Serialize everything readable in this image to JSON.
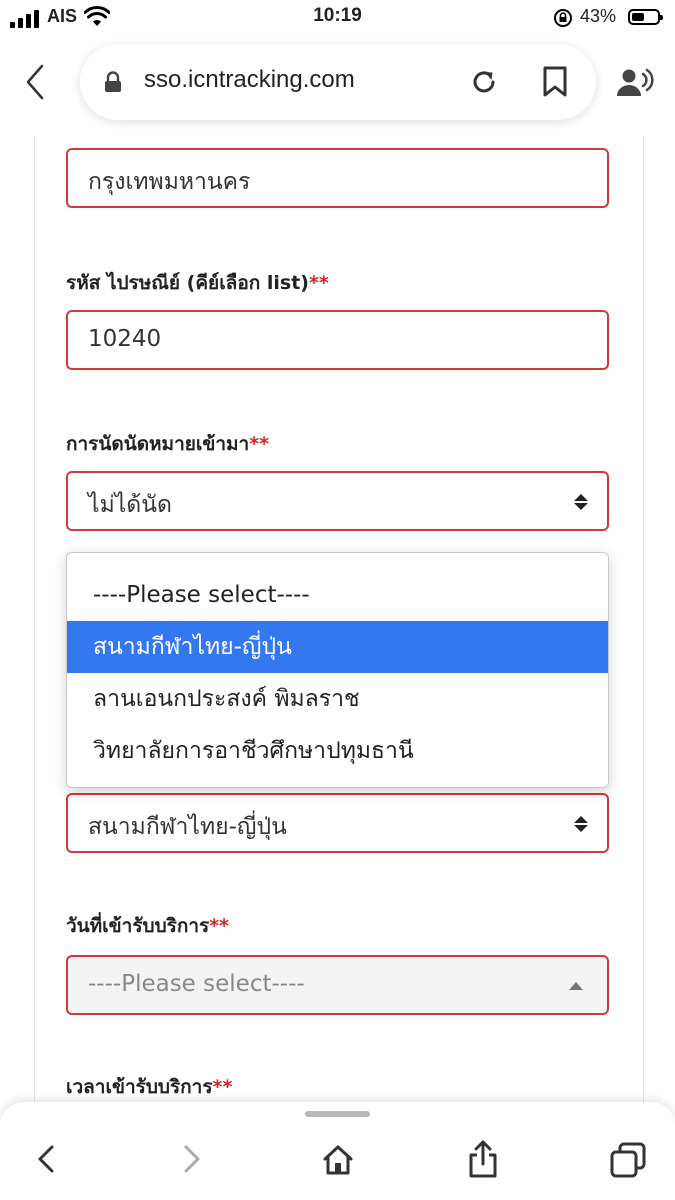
{
  "status_bar": {
    "carrier": "AIS",
    "time": "10:19",
    "battery": "43%",
    "icons": [
      "signal-icon",
      "wifi-icon",
      "orientation-lock-icon",
      "battery-icon"
    ]
  },
  "browser": {
    "url": "sso.icntracking.com",
    "icons": [
      "back-icon",
      "lock-icon",
      "reload-icon",
      "bookmark-icon",
      "reader-voice-icon"
    ]
  },
  "form": {
    "province_value": "กรุงเทพมหานคร",
    "postal_label": "รหัส ไปรษณีย์ (คีย์เลือก list)",
    "postal_value": "10240",
    "appointment_label": "การนัดนัดหมายเข้ามา",
    "appointment_value": "ไม่ได้นัด",
    "location_value": "สนามกีฬาไทย-ญี่ปุ่น",
    "date_label": "วันที่เข้ารับบริการ",
    "date_placeholder": "----Please select----",
    "time_label": "เวลาเข้ารับบริการ",
    "required_mark": "**"
  },
  "dropdown": {
    "options": [
      "----Please select----",
      "สนามกีฬาไทย-ญี่ปุ่น",
      "ลานเอนกประสงค์ พิมลราช",
      "วิทยาลัยการอาชีวศึกษาปทุมธานี"
    ],
    "selected_index": 1
  },
  "toolbar": {
    "icons": [
      "back-icon",
      "forward-icon",
      "home-icon",
      "share-icon",
      "tabs-icon"
    ]
  },
  "colors": {
    "accent": "#3478f0",
    "error_border": "#d03a3a",
    "required": "#d02828"
  }
}
